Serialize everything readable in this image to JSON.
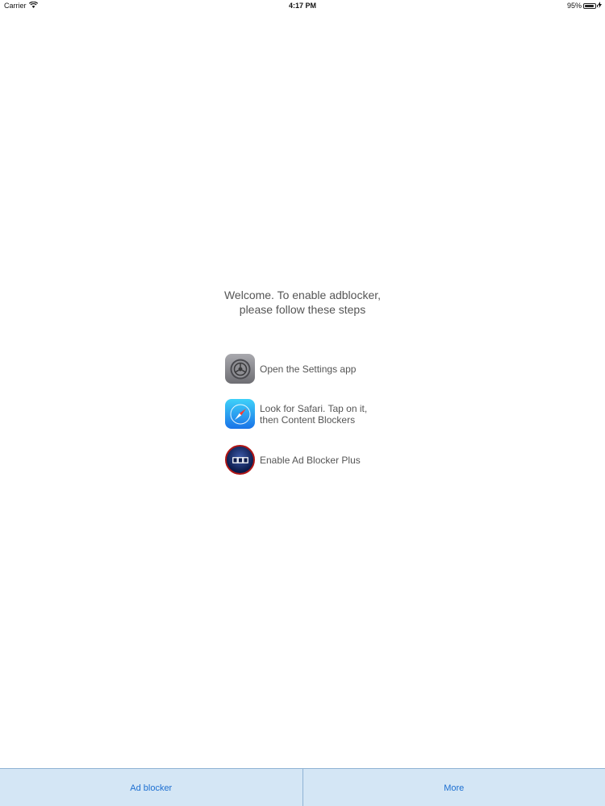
{
  "status_bar": {
    "carrier": "Carrier",
    "wifi_icon": "wifi-icon",
    "time": "4:17 PM",
    "battery_percent_label": "95%",
    "battery_level": 0.95,
    "charging_icon": "charging-bolt-icon"
  },
  "welcome": {
    "text": "Welcome. To enable adblocker, please follow these steps"
  },
  "steps": [
    {
      "icon": "settings-app-icon",
      "text": "Open the Settings app"
    },
    {
      "icon": "safari-app-icon",
      "text": "Look for Safari. Tap on it, then Content Blockers"
    },
    {
      "icon": "ad-blocker-plus-icon",
      "text": "Enable Ad Blocker Plus"
    }
  ],
  "tab_bar": {
    "tabs": [
      {
        "label": "Ad blocker"
      },
      {
        "label": "More"
      }
    ]
  },
  "colors": {
    "tab_bar_background": "#d4e6f5",
    "tab_label": "#1d6fd1",
    "body_text": "#555555"
  }
}
